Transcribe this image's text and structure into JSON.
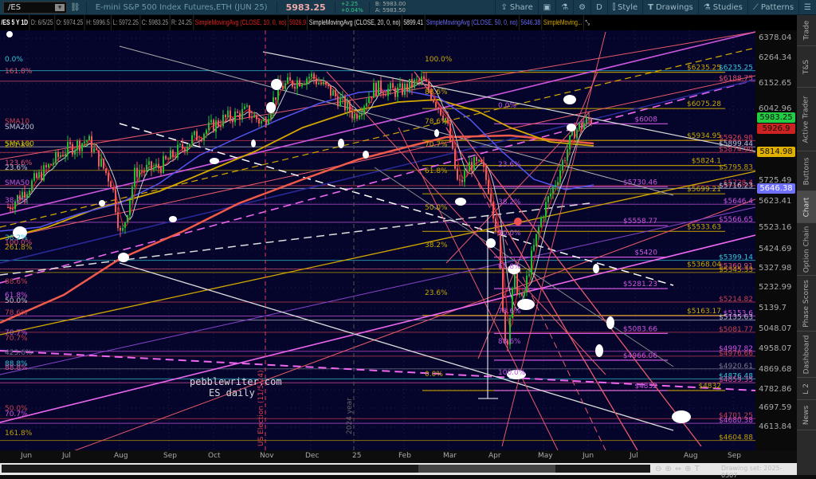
{
  "toolbar": {
    "symbol": "/ES",
    "description": "E-mini S&P 500 Index Futures,ETH (JUN 25)",
    "last": "5983.25",
    "change": "+2.25",
    "change_pct": "+0.04%",
    "bid": "B: 5983.00",
    "ask": "A: 5983.50",
    "buttons": {
      "share": "Share",
      "timeframe": "D",
      "style": "Style",
      "drawings": "Drawings",
      "studies": "Studies",
      "patterns": "Patterns"
    }
  },
  "info": {
    "symbol_period": "/ES 5 Y 1D",
    "date": "D: 6/5/25",
    "open": "O: 5974.25",
    "high": "H: 5996.5",
    "low": "L: 5972.25",
    "close": "C: 5983.25",
    "range": "R: 24.25",
    "studies": [
      {
        "name": "SimpleMovingAvg (CLOSE, 10, 0, no)",
        "value": "5926.9",
        "color": "#e02020"
      },
      {
        "name": "SimpleMovingAvg (CLOSE, 20, 0, no)",
        "value": "5899.41",
        "color": "#e0e0e0"
      },
      {
        "name": "SimpleMovingAvg (CLOSE, 50, 0, no)",
        "value": "5646.38",
        "color": "#6a6aff"
      },
      {
        "name": "SimpleMoving...",
        "value": "",
        "color": "#d4a800"
      }
    ]
  },
  "price_axis": {
    "ticks": [
      "6378.04",
      "6264.34",
      "6152.65",
      "6042.96",
      "5725.49",
      "5623.41",
      "5523.16",
      "5424.69",
      "5327.98",
      "5232.99",
      "5139.7",
      "5048.07",
      "4958.07",
      "4869.68",
      "4782.86",
      "4697.59",
      "4613.84"
    ],
    "badges": [
      {
        "value": "5983.25",
        "color": "#22cc44"
      },
      {
        "value": "5926.9",
        "color": "#cc2222"
      },
      {
        "value": "5814.98",
        "color": "#e0b000"
      },
      {
        "value": "5646.38",
        "color": "#7070ff"
      }
    ]
  },
  "time_axis": [
    "Jun",
    "Jul",
    "Aug",
    "Sep",
    "Oct",
    "Nov",
    "Dec",
    "25",
    "Feb",
    "Mar",
    "Apr",
    "May",
    "Jun",
    "Jul",
    "Aug",
    "Sep"
  ],
  "price_path": [
    [
      -0.39,
      5633
    ],
    [
      0.12,
      5739
    ],
    [
      0.79,
      5879
    ],
    [
      1.3,
      5932
    ],
    [
      1.81,
      5739
    ],
    [
      2.01,
      5493
    ],
    [
      2.31,
      5791
    ],
    [
      2.82,
      5809
    ],
    [
      3.5,
      5932
    ],
    [
      4.17,
      6020
    ],
    [
      4.68,
      6055
    ],
    [
      5.02,
      6002
    ],
    [
      5.35,
      6160
    ],
    [
      6.03,
      6213
    ],
    [
      6.54,
      6125
    ],
    [
      6.96,
      6037
    ],
    [
      7.38,
      6160
    ],
    [
      7.89,
      6143
    ],
    [
      8.4,
      6195
    ],
    [
      8.65,
      6108
    ],
    [
      8.9,
      6020
    ],
    [
      9.16,
      5721
    ],
    [
      9.41,
      5826
    ],
    [
      9.66,
      5809
    ],
    [
      9.83,
      5703
    ],
    [
      10.0,
      5493
    ],
    [
      10.17,
      5001
    ],
    [
      10.34,
      5317
    ],
    [
      10.51,
      5212
    ],
    [
      10.68,
      5387
    ],
    [
      10.93,
      5598
    ],
    [
      11.27,
      5774
    ],
    [
      11.6,
      5967
    ],
    [
      11.94,
      6020
    ]
  ],
  "levels": {
    "right": [
      {
        "label": "$6235.25",
        "color": "#33c6d6"
      },
      {
        "label": "$6188.75",
        "color": "#e0506a"
      },
      {
        "label": "$5926.98",
        "color": "#e04050"
      },
      {
        "label": "$5899.44",
        "color": "#c0c0d0"
      },
      {
        "label": "$5874.90",
        "color": "#e04050"
      },
      {
        "label": "$5795.83",
        "color": "#c0a000"
      },
      {
        "label": "$5728.4",
        "color": "#e04050"
      },
      {
        "label": "$5716.23",
        "color": "#c0c0d0"
      },
      {
        "label": "$5646.4",
        "color": "#cc55dd"
      },
      {
        "label": "$5566.65",
        "color": "#cc55dd"
      },
      {
        "label": "$5399.14",
        "color": "#33c6d6"
      },
      {
        "label": "$5360.91",
        "color": "#e0506a"
      },
      {
        "label": "$5345.33",
        "color": "#c0a000"
      },
      {
        "label": "$5214.82",
        "color": "#c84050"
      },
      {
        "label": "$5153.6",
        "color": "#cc55dd"
      },
      {
        "label": "$5135.63",
        "color": "#c0c0d0"
      },
      {
        "label": "$5081.77",
        "color": "#c84050"
      },
      {
        "label": "$4997.82",
        "color": "#cc55dd"
      },
      {
        "label": "$4976.66",
        "color": "#c84050"
      },
      {
        "label": "$4920.61",
        "color": "#777788"
      },
      {
        "label": "$4876.48",
        "color": "#33c6d6"
      },
      {
        "label": "$4859.35",
        "color": "#e050a0"
      },
      {
        "label": "$4701.25",
        "color": "#c84050"
      },
      {
        "label": "$4680.38",
        "color": "#cc55dd"
      },
      {
        "label": "$4604.88",
        "color": "#c0a000"
      }
    ],
    "gold": [
      "$6235.25",
      "$6075.28",
      "$5934.95",
      "$5824.1",
      "$5699.21",
      "$5533.63",
      "$5368.04",
      "$5163.17",
      "$4832"
    ],
    "magenta": [
      "$6008",
      "$5730.46",
      "$5558.77",
      "$5420",
      "$5281.23",
      "$5083.66",
      "$4966.06",
      "$4832"
    ]
  },
  "fib_labels": {
    "left": [
      "0.0%",
      "161.8%",
      "SMA10",
      "SMA200",
      "261.8%",
      "SMA100",
      "123.6%",
      "23.6%",
      "SMA50",
      "38.2%",
      "38.2%",
      "100.0%",
      "261.8%",
      "88.6%",
      "61.8%",
      "50.0%",
      "78.6%",
      "70.7%",
      "70.7%",
      "423.6%",
      "88.8%",
      "88.8%",
      "50.0%",
      "70.7%",
      "161.8%"
    ],
    "mid_a": [
      "100.0%",
      "88.6%",
      "78.6%",
      "70.7%",
      "61.8%",
      "50.0%",
      "38.2%",
      "23.6%",
      "0.0%"
    ],
    "mid_b": [
      "0.0%",
      "23.6%",
      "38.2%",
      "50.0%",
      "61.8%",
      "78.6%",
      "88.6%",
      "100.0%"
    ]
  },
  "annotations": {
    "watermark_1": "pebblewriter.com",
    "watermark_2": "ES daily",
    "election": "US Election (11/5/24)",
    "year": "2024 year"
  },
  "sidebar_tabs": [
    "Trade",
    "T&S",
    "Active Trader",
    "Buttons",
    "Chart",
    "Option Chain",
    "Phase Scores",
    "Dashboard",
    "L 2",
    "News"
  ],
  "footer": {
    "drawing_set": "Drawing set: 2025-0507"
  }
}
